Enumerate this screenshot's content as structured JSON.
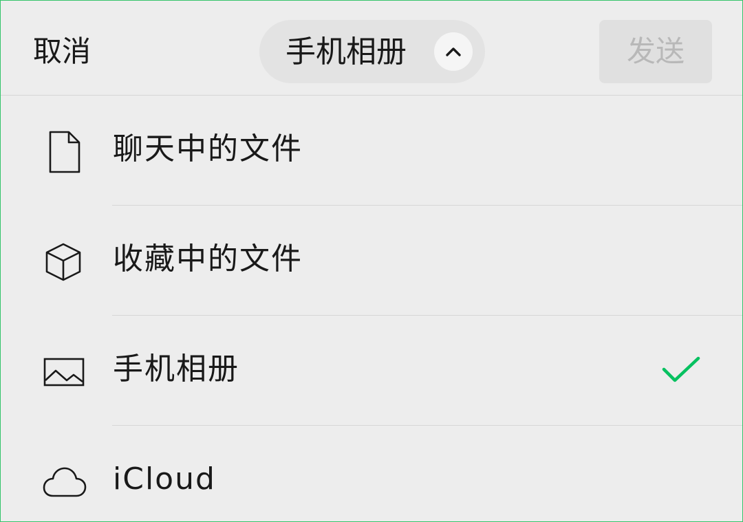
{
  "header": {
    "cancel_label": "取消",
    "source_selector": {
      "label": "手机相册",
      "icon": "chevron-up-icon"
    },
    "send_label": "发送"
  },
  "list": {
    "items": [
      {
        "label": "聊天中的文件",
        "icon": "document-icon",
        "selected": false
      },
      {
        "label": "收藏中的文件",
        "icon": "cube-icon",
        "selected": false
      },
      {
        "label": "手机相册",
        "icon": "image-icon",
        "selected": true
      },
      {
        "label": "iCloud",
        "icon": "cloud-icon",
        "selected": false
      }
    ]
  },
  "colors": {
    "background": "#ededed",
    "accent": "#07c160",
    "text": "#191919",
    "disabled_text": "#b8b8b8",
    "divider": "#d6d6d6"
  }
}
